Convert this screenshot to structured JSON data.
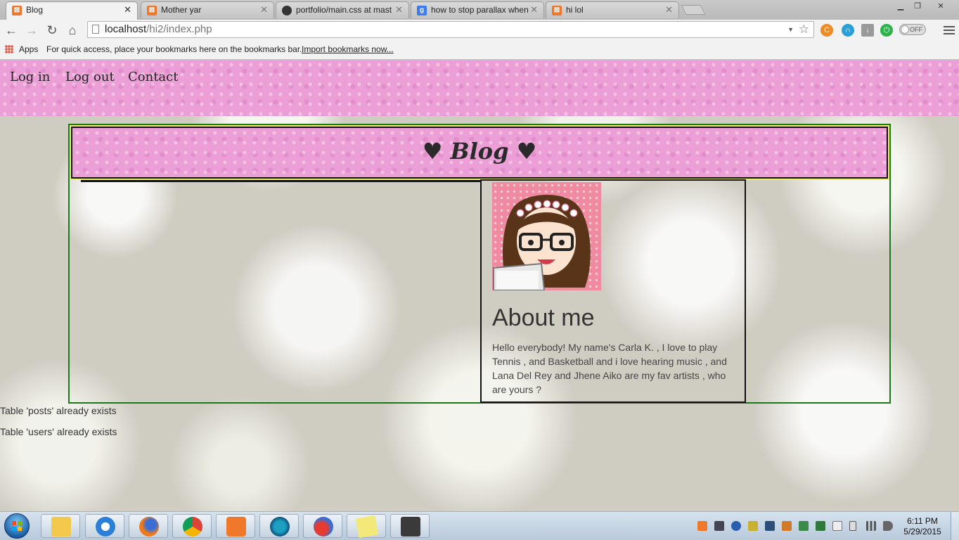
{
  "browser": {
    "tabs": [
      {
        "title": "Blog",
        "favicon": "xampp-icon",
        "active": true
      },
      {
        "title": "Mother yar",
        "favicon": "xampp-icon"
      },
      {
        "title": "portfolio/main.css at mast",
        "favicon": "github-icon"
      },
      {
        "title": "how to stop parallax when",
        "favicon": "google-icon"
      },
      {
        "title": "hi lol",
        "favicon": "xampp-icon"
      }
    ],
    "url_host": "localhost",
    "url_path": "/hi2/index.php",
    "toggle_label": "OFF",
    "bookmarks": {
      "apps_label": "Apps",
      "hint": "For quick access, place your bookmarks here on the bookmarks bar.",
      "import_link": "Import bookmarks now..."
    }
  },
  "site": {
    "nav": [
      "Log in",
      "Log out",
      "Contact"
    ],
    "header_title": "♥ Blog ♥",
    "about": {
      "title": "About me",
      "text": "Hello everybody! My name's Carla K. , I love to play Tennis , and Basketball and i love hearing music , and Lana Del Rey and Jhene Aiko are my fav artists , who are yours ?"
    },
    "messages": [
      "Table 'posts' already exists",
      "Table 'users' already exists"
    ]
  },
  "taskbar": {
    "apps": [
      "file-explorer-icon",
      "internet-explorer-icon",
      "firefox-icon",
      "chrome-icon",
      "xampp-icon",
      "app-icon",
      "browser-icon",
      "sticky-notes-icon",
      "sublime-text-icon"
    ],
    "time": "6:11 PM",
    "date": "5/29/2015"
  },
  "colors": {
    "pink": "#ec9fd6",
    "container_border": "#1a7a1a",
    "header_outline": "#f5f06a"
  }
}
